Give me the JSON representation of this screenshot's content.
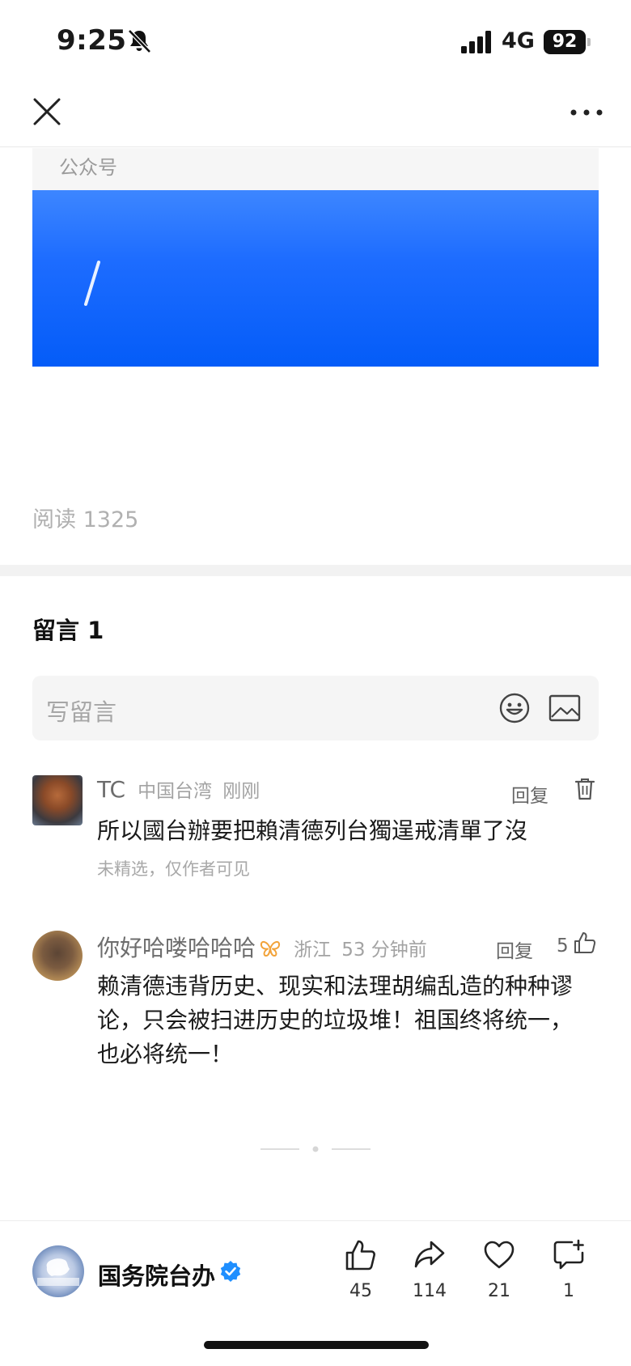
{
  "status": {
    "time": "9:25",
    "network": "4G",
    "battery": "92",
    "icons": [
      "bell-muted-icon",
      "signal-icon"
    ]
  },
  "nav": {
    "close_icon": "close-icon",
    "more_icon": "more-icon"
  },
  "article": {
    "account_type_label": "公众号",
    "read_count": "阅读 1325",
    "banner_color": "#1d6cff"
  },
  "comments": {
    "title": "留言 1",
    "input_placeholder": "写留言",
    "items": [
      {
        "nickname": "TC",
        "location": "中国台湾",
        "time": "刚刚",
        "reply_label": "回复",
        "text": "所以國台辦要把賴清德列台獨逞戒清單了沒",
        "note": "未精选，仅作者可见"
      },
      {
        "nickname": "你好哈喽哈哈哈",
        "location": "浙江",
        "time": "53 分钟前",
        "reply_label": "回复",
        "likes": "5",
        "text": "赖清德违背历史、现实和法理胡编乱造的种种谬论，只会被扫进历史的垃圾堆！祖国终将统一，也必将统一！"
      }
    ]
  },
  "footer": {
    "account_name": "国务院台办",
    "actions": {
      "like": "45",
      "share": "114",
      "favorite": "21",
      "comment": "1"
    },
    "accent": "#1f8fff"
  }
}
